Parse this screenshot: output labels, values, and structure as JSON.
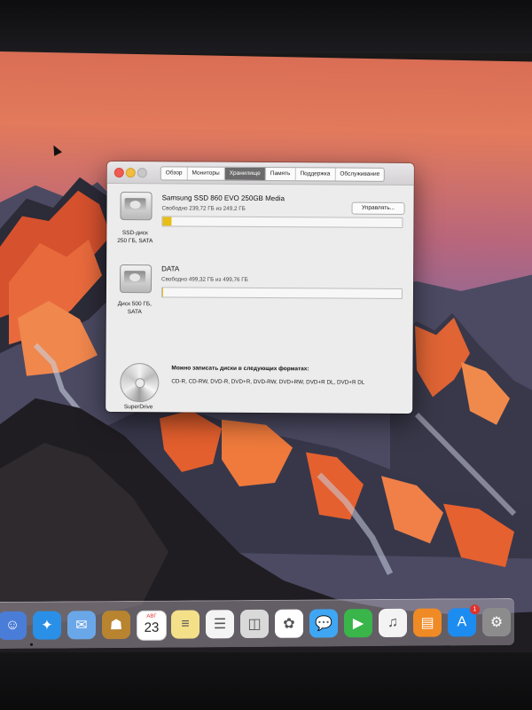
{
  "window": {
    "tabs": [
      {
        "label": "Обзор",
        "active": false
      },
      {
        "label": "Мониторы",
        "active": false
      },
      {
        "label": "Хранилище",
        "active": true
      },
      {
        "label": "Память",
        "active": false
      },
      {
        "label": "Поддержка",
        "active": false
      },
      {
        "label": "Обслуживание",
        "active": false
      }
    ],
    "drives": [
      {
        "icon": "hard-drive-icon",
        "caption": "SSD-диск\n250 ГБ, SATA",
        "name": "Samsung SSD 860 EVO 250GB Media",
        "free_text": "Свободно 239,72 ГБ из 249,2 ГБ",
        "used_fraction": 0.038,
        "button_label": "Управлять..."
      },
      {
        "icon": "hard-drive-icon",
        "caption": "Диск 500 ГБ,\nSATA",
        "name": "DATA",
        "free_text": "Свободно 499,32 ГБ из 499,76 ГБ",
        "used_fraction": 0.001
      }
    ],
    "superdrive": {
      "icon": "cd-icon",
      "caption": "SuperDrive",
      "label": "Можно записать диски в следующих форматах:",
      "formats": "CD-R, CD-RW, DVD-R, DVD+R, DVD-RW, DVD+RW, DVD+R DL, DVD+R DL"
    },
    "bar_color": "#e8bd16"
  },
  "dock": {
    "items": [
      {
        "name": "finder-icon",
        "color": "#4a7dd8",
        "glyph": "☺"
      },
      {
        "name": "safari-icon",
        "color": "#2a8fe6",
        "glyph": "✦"
      },
      {
        "name": "mail-icon",
        "color": "#6aa7e8",
        "glyph": "✉"
      },
      {
        "name": "contacts-icon",
        "color": "#b8842f",
        "glyph": "☗"
      },
      {
        "name": "calendar-icon",
        "color": "#ffffff",
        "glyph": "",
        "month": "АВГ",
        "day": "23"
      },
      {
        "name": "notes-icon",
        "color": "#f5e08a",
        "glyph": "≡"
      },
      {
        "name": "reminders-icon",
        "color": "#f4f4f4",
        "glyph": "☰"
      },
      {
        "name": "preview-icon",
        "color": "#d9d9d9",
        "glyph": "◫"
      },
      {
        "name": "photos-icon",
        "color": "#ffffff",
        "glyph": "✿"
      },
      {
        "name": "messages-icon",
        "color": "#3fa6f4",
        "glyph": "💬"
      },
      {
        "name": "facetime-icon",
        "color": "#39b54a",
        "glyph": "▶"
      },
      {
        "name": "itunes-icon",
        "color": "#f3f3f3",
        "glyph": "♫"
      },
      {
        "name": "ibooks-icon",
        "color": "#f08a24",
        "glyph": "▤"
      },
      {
        "name": "app-store-icon",
        "color": "#1d8cf0",
        "glyph": "A",
        "badge": "1"
      },
      {
        "name": "system-preferences-icon",
        "color": "#8c8c8c",
        "glyph": "⚙"
      }
    ]
  }
}
